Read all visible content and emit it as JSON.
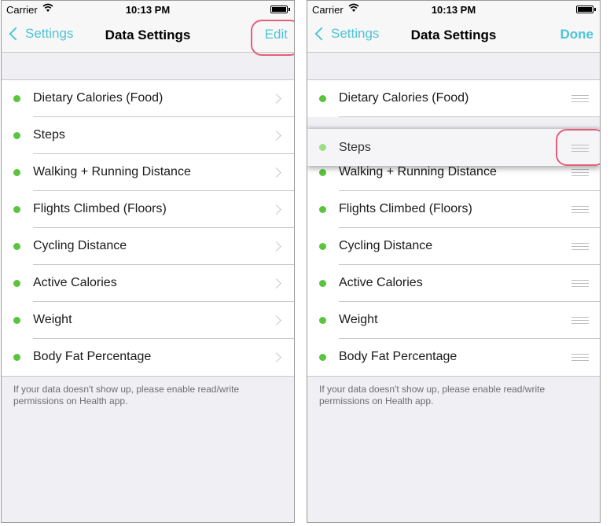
{
  "colors": {
    "accent": "#4ec4d4",
    "dot": "#5ac43d",
    "highlight": "#e45f7a",
    "background": "#efeff4"
  },
  "screens": [
    {
      "status": {
        "carrier": "Carrier",
        "time": "10:13 PM"
      },
      "nav": {
        "back_label": "Settings",
        "title": "Data Settings",
        "action_label": "Edit"
      },
      "items": [
        {
          "label": "Dietary Calories (Food)"
        },
        {
          "label": "Steps"
        },
        {
          "label": "Walking + Running Distance"
        },
        {
          "label": "Flights Climbed (Floors)"
        },
        {
          "label": "Cycling Distance"
        },
        {
          "label": "Active Calories"
        },
        {
          "label": "Weight"
        },
        {
          "label": "Body Fat Percentage"
        }
      ],
      "footer": "If your data doesn't show up, please enable read/write permissions on Health app."
    },
    {
      "status": {
        "carrier": "Carrier",
        "time": "10:13 PM"
      },
      "nav": {
        "back_label": "Settings",
        "title": "Data Settings",
        "action_label": "Done"
      },
      "items": [
        {
          "label": "Dietary Calories (Food)"
        },
        {
          "label": ""
        },
        {
          "label": "Walking + Running Distance"
        },
        {
          "label": "Flights Climbed (Floors)"
        },
        {
          "label": "Cycling Distance"
        },
        {
          "label": "Active Calories"
        },
        {
          "label": "Weight"
        },
        {
          "label": "Body Fat Percentage"
        }
      ],
      "dragging_item": {
        "label": "Steps"
      },
      "footer": "If your data doesn't show up, please enable read/write permissions on Health app."
    }
  ]
}
